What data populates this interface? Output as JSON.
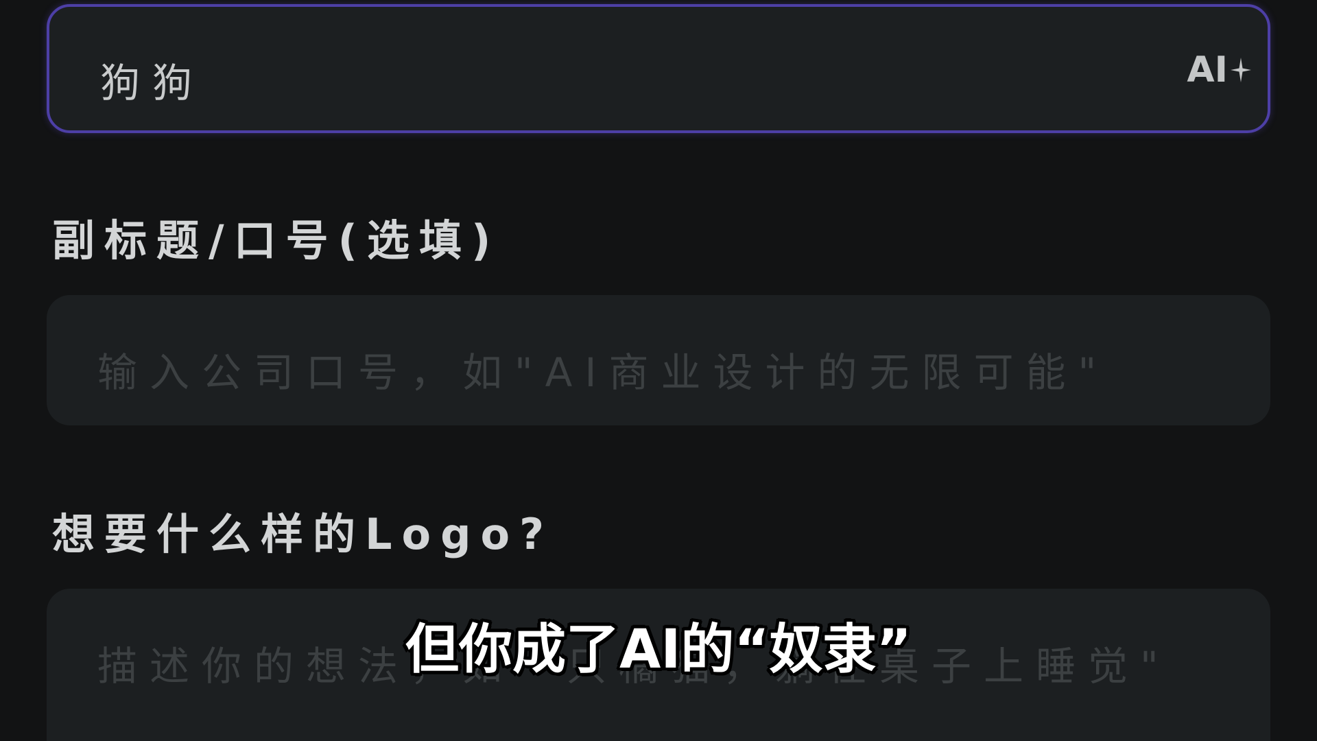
{
  "name_field": {
    "value": "狗狗",
    "ai_button_label": "AI",
    "ai_button_icon": "sparkle-icon"
  },
  "slogan_section": {
    "label": "副标题/口号(选填)",
    "placeholder": "输入公司口号，如\"AI商业设计的无限可能\""
  },
  "logo_section": {
    "label": "想要什么样的Logo?",
    "placeholder": "描述你的想法，如一只橘猫，躺在桌子上睡觉\""
  },
  "subtitle": {
    "text": "但你成了AI的“奴隶”"
  },
  "colors": {
    "background": "#121314",
    "field_background": "#1c1f21",
    "active_border": "#4d3fa6",
    "label_text": "#d3d5d6",
    "placeholder_text": "#3c4042"
  }
}
